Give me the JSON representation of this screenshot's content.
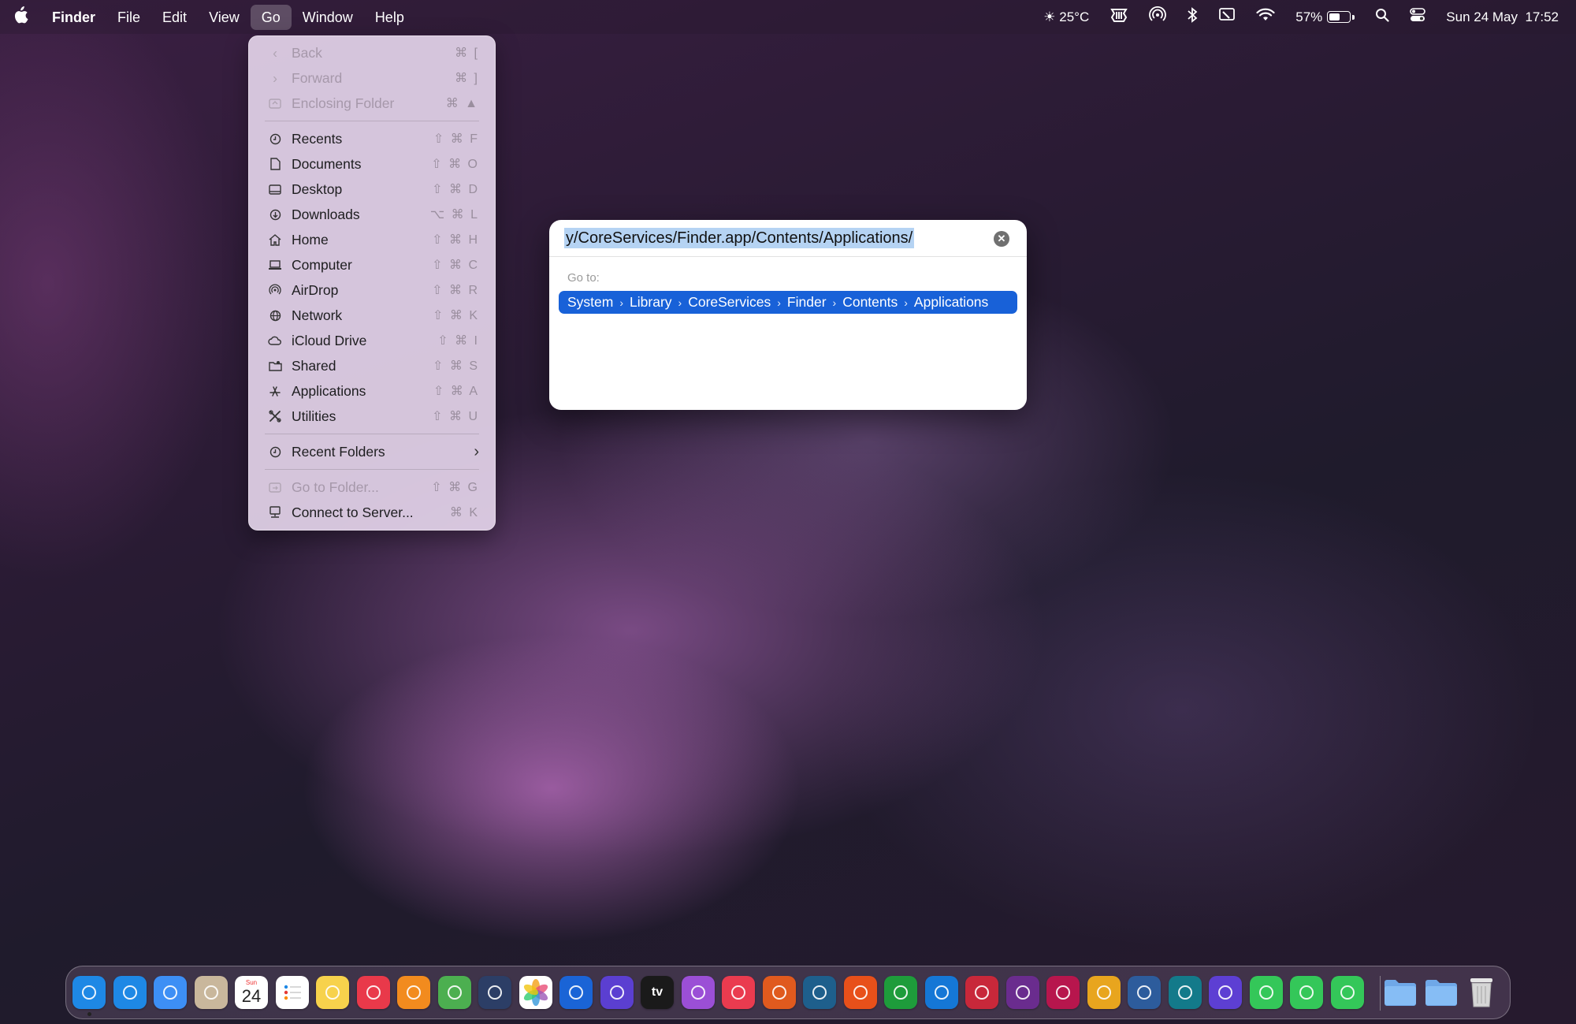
{
  "menubar": {
    "apple": "",
    "app": "Finder",
    "menus": [
      "File",
      "Edit",
      "View",
      "Go",
      "Window",
      "Help"
    ],
    "weather": "☀ 25°C",
    "battery": "57%",
    "battery_level": 0.57,
    "datetime": "Sun 24 May  17:52"
  },
  "go_menu": {
    "back": "Back",
    "back_sc": "⌘ [",
    "forward": "Forward",
    "forward_sc": "⌘ ]",
    "enclosing": "Enclosing Folder",
    "enclosing_sc": "⌘ ▲",
    "recents": "Recents",
    "recents_sc": "⇧ ⌘ F",
    "documents": "Documents",
    "documents_sc": "⇧ ⌘ O",
    "desktop": "Desktop",
    "desktop_sc": "⇧ ⌘ D",
    "downloads": "Downloads",
    "downloads_sc": "⌥ ⌘ L",
    "home": "Home",
    "home_sc": "⇧ ⌘ H",
    "computer": "Computer",
    "computer_sc": "⇧ ⌘ C",
    "airdrop": "AirDrop",
    "airdrop_sc": "⇧ ⌘ R",
    "network": "Network",
    "network_sc": "⇧ ⌘ K",
    "icloud": "iCloud Drive",
    "icloud_sc": "⇧ ⌘ I",
    "shared": "Shared",
    "shared_sc": "⇧ ⌘ S",
    "applications": "Applications",
    "applications_sc": "⇧ ⌘ A",
    "utilities": "Utilities",
    "utilities_sc": "⇧ ⌘ U",
    "recent_folders": "Recent Folders",
    "goto_folder": "Go to Folder...",
    "goto_folder_sc": "⇧ ⌘ G",
    "connect": "Connect to Server...",
    "connect_sc": "⌘ K"
  },
  "goto_dialog": {
    "path": "y/CoreServices/Finder.app/Contents/Applications/",
    "label": "Go to:",
    "crumbs": [
      "System",
      "Library",
      "CoreServices",
      "Finder",
      "Contents",
      "Applications"
    ],
    "separator": "›"
  },
  "dock": {
    "calendar_month": "Sun",
    "calendar_day": "24",
    "tv_label": "tv",
    "icons": [
      "finder-icon",
      "safari-icon",
      "mail-icon",
      "contacts-icon",
      "calendar-icon",
      "reminders-icon",
      "notes-icon",
      "news-icon",
      "books-icon",
      "maps-icon",
      "disk-utility-icon",
      "photos-icon",
      "quicktime-icon",
      "imovie-icon",
      "apple-tv-icon",
      "podcasts-icon",
      "music-icon",
      "garageband-icon",
      "freeform-icon",
      "pages-icon",
      "numbers-icon",
      "keynote-icon",
      "app-icon",
      "motion-icon",
      "affinity-icon",
      "mailbird-icon",
      "compressor-icon",
      "app-icon",
      "shortcuts-icon",
      "messages-icon",
      "phone-icon",
      "facetime-icon",
      "applications-folder-icon",
      "downloads-folder-icon",
      "trash-icon"
    ],
    "colors": [
      "#1e88e5",
      "#1e88e5",
      "#3d8ff5",
      "#c9b79c",
      "#ffffff",
      "#ffffff",
      "#f7d24c",
      "#e9394a",
      "#f28b1e",
      "#4caf50",
      "#2c3e66",
      "#ffffff",
      "#1a64d6",
      "#5b3fd1",
      "#1a1a1a",
      "#9b4fd6",
      "#ea3b4f",
      "#e05a1e",
      "#1e5f8c",
      "#e8501a",
      "#1e9c3b",
      "#1577d6",
      "#c8283a",
      "#6a2c8e",
      "#b7164d",
      "#e8a51e",
      "#2d5c9c",
      "#137a8a",
      "#5d3fd3",
      "#34c759",
      "#34c759",
      "#34c759",
      "#6fa8e8",
      "#6fa8e8",
      "#cfcfcf"
    ]
  }
}
